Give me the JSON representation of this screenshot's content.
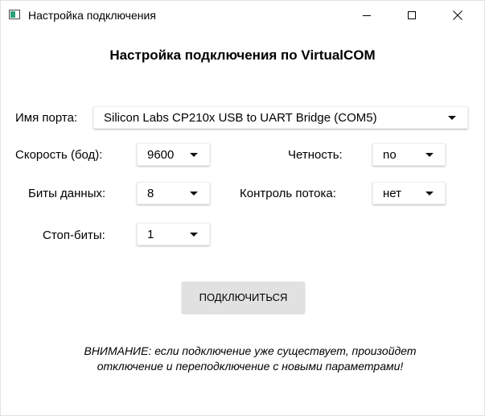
{
  "window": {
    "title": "Настройка подключения"
  },
  "heading": "Настройка подключения по VirtualCOM",
  "port": {
    "label": "Имя порта:",
    "value": "Silicon Labs CP210x USB to UART Bridge (COM5)"
  },
  "baud": {
    "label": "Скорость (бод):",
    "value": "9600"
  },
  "parity": {
    "label": "Четность:",
    "value": "no"
  },
  "data_bits": {
    "label": "Биты данных:",
    "value": "8"
  },
  "flow_control": {
    "label": "Контроль потока:",
    "value": "нет"
  },
  "stop_bits": {
    "label": "Стоп-биты:",
    "value": "1"
  },
  "connect_button": {
    "label": "ПОДКЛЮЧИТЬСЯ"
  },
  "warning": {
    "line1": "ВНИМАНИЕ: если подключение уже существует, произойдет",
    "line2": "отключение и переподключение с новыми параметрами!"
  }
}
